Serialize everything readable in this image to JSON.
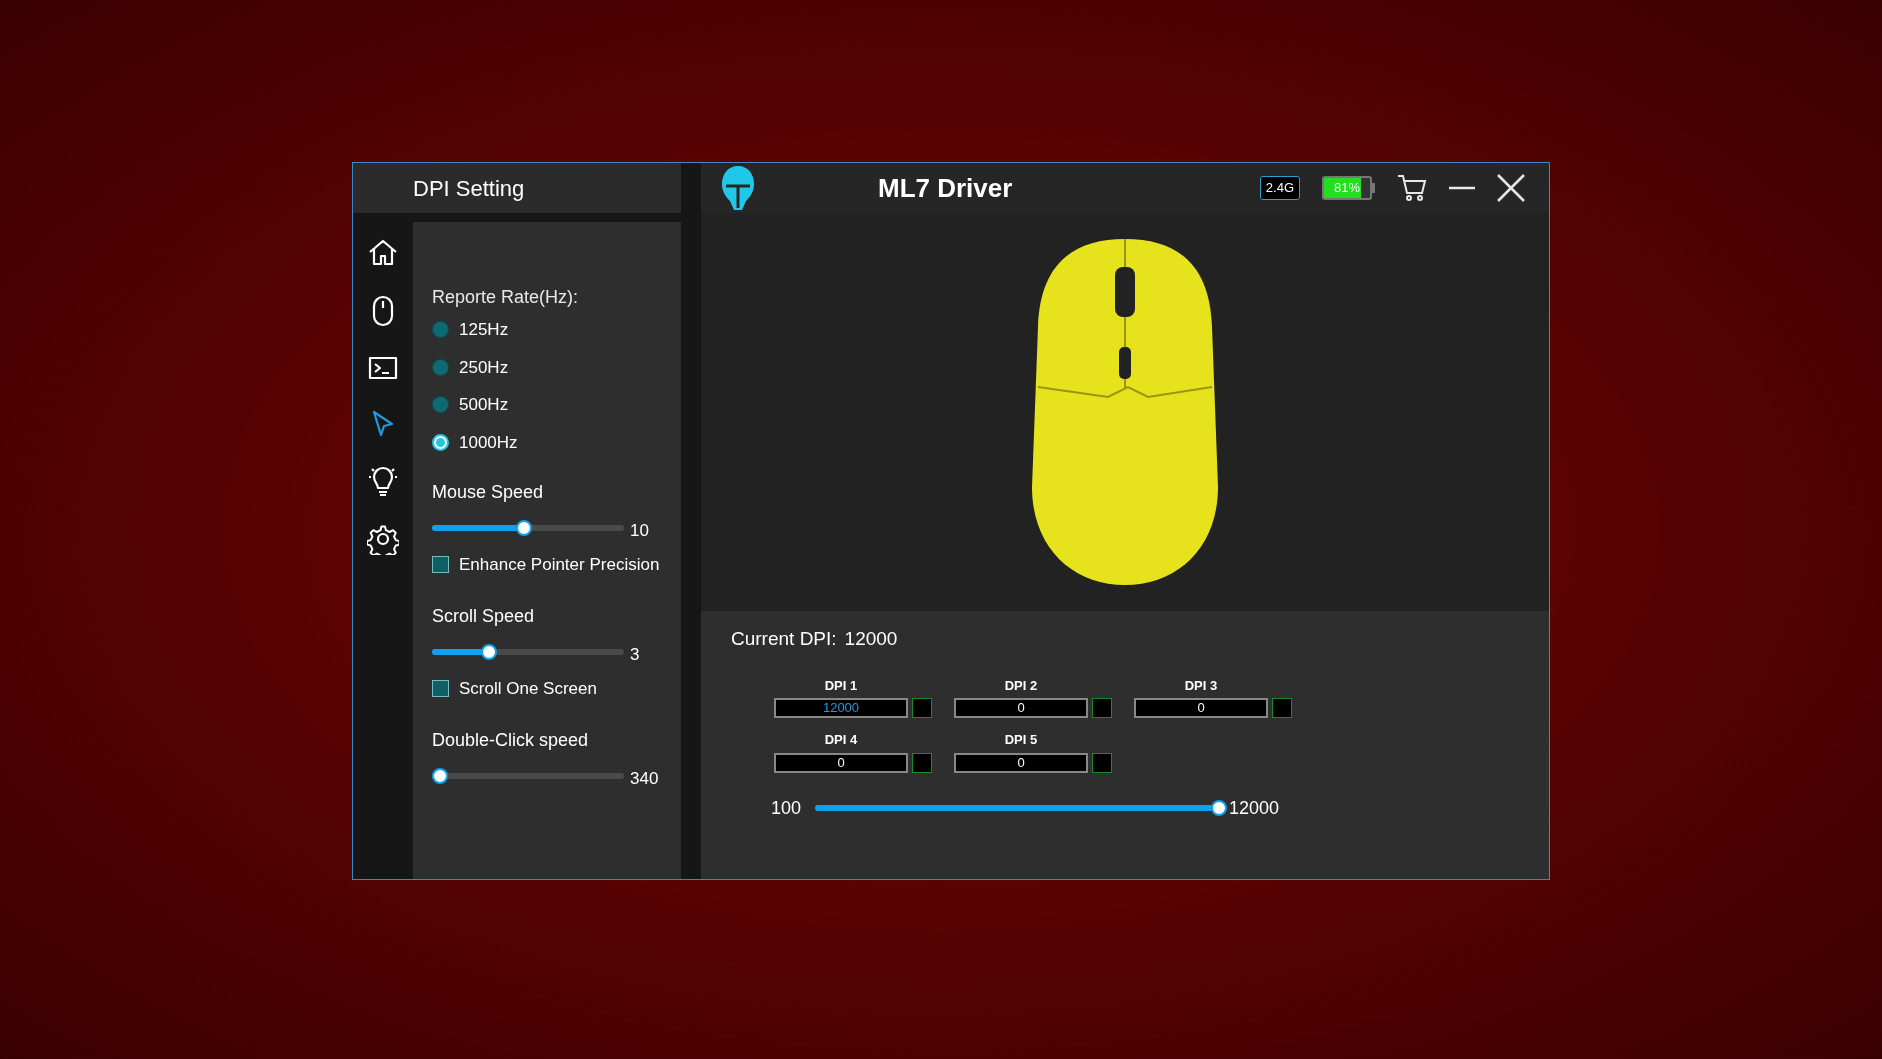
{
  "settings_panel": {
    "title": "DPI Setting",
    "nav": [
      {
        "kind": "home",
        "selected": false
      },
      {
        "kind": "mouse",
        "selected": false
      },
      {
        "kind": "terminal",
        "selected": false
      },
      {
        "kind": "pointer",
        "selected": true
      },
      {
        "kind": "light",
        "selected": false
      },
      {
        "kind": "gear",
        "selected": false
      }
    ],
    "report_rate": {
      "label": "Reporte Rate(Hz):",
      "options": [
        {
          "label": "125Hz",
          "selected": false
        },
        {
          "label": "250Hz",
          "selected": false
        },
        {
          "label": "500Hz",
          "selected": false
        },
        {
          "label": "1000Hz",
          "selected": true
        }
      ]
    },
    "controls": [
      {
        "kind": "slider",
        "label": "Mouse Speed",
        "level": 0.48,
        "reading": "10"
      },
      {
        "kind": "checkbox",
        "label": "Enhance Pointer Precision",
        "checked": false
      },
      {
        "kind": "slider",
        "label": "Scroll Speed",
        "level": 0.28,
        "reading": "3"
      },
      {
        "kind": "checkbox",
        "label": "Scroll One Screen",
        "checked": false
      },
      {
        "kind": "slider",
        "label": "Double-Click speed",
        "level": 0,
        "reading": "340"
      }
    ]
  },
  "window": {
    "title": "ML7 Driver",
    "connection": "2.4G",
    "battery": {
      "reading": "81%",
      "level": 0.81
    }
  },
  "dpi": {
    "current_label": "Current DPI:",
    "current_value": "12000",
    "slots": [
      {
        "label": "DPI 1",
        "value": "12000",
        "selected": true
      },
      {
        "label": "DPI 2",
        "value": "0",
        "selected": false
      },
      {
        "label": "DPI 3",
        "value": "0",
        "selected": false
      },
      {
        "label": "DPI 4",
        "value": "0",
        "selected": false
      },
      {
        "label": "DPI 5",
        "value": "0",
        "selected": false
      }
    ],
    "range": {
      "min": "100",
      "max": "12000",
      "level": 1
    }
  }
}
